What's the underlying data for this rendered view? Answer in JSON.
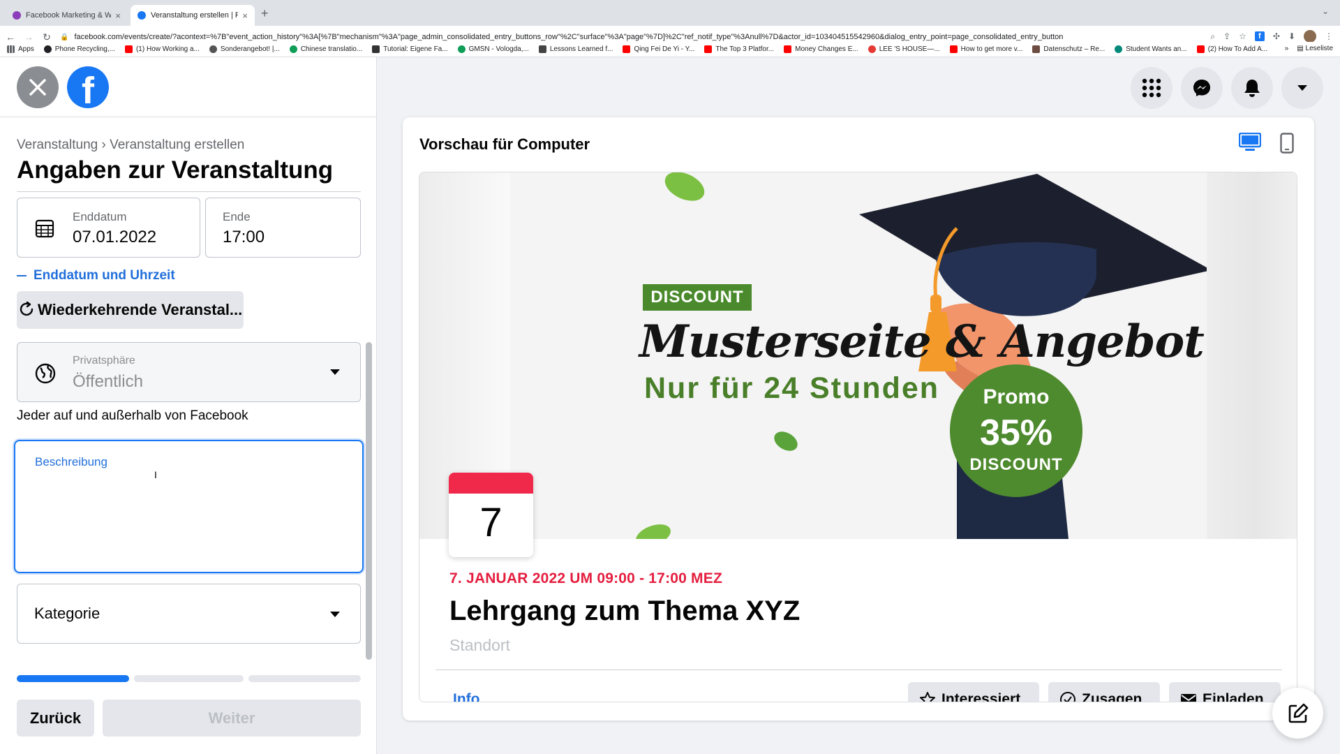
{
  "browser": {
    "tabs": [
      {
        "title": "Facebook Marketing & Werbea",
        "favicon_color": "#8b3dba"
      },
      {
        "title": "Veranstaltung erstellen | Faceb",
        "favicon_color": "#1877f2"
      }
    ],
    "new_tab": "+",
    "url": "facebook.com/events/create/?acontext=%7B\"event_action_history\"%3A[%7B\"mechanism\"%3A\"page_admin_consolidated_entry_buttons_row\"%2C\"surface\"%3A\"page\"%7D]%2C\"ref_notif_type\"%3Anull%7D&actor_id=103404515542960&dialog_entry_point=page_consolidated_entry_button",
    "bookmarks": [
      {
        "label": "Apps",
        "color": "#5f6368"
      },
      {
        "label": "Phone Recycling,...",
        "color": "#202124"
      },
      {
        "label": "(1) How Working a...",
        "color": "#ff0000"
      },
      {
        "label": "Sonderangebot! |...",
        "color": "#555555"
      },
      {
        "label": "Chinese translatio...",
        "color": "#0f9d58"
      },
      {
        "label": "Tutorial: Eigene Fa...",
        "color": "#333333"
      },
      {
        "label": "GMSN - Vologda,...",
        "color": "#0f9d58"
      },
      {
        "label": "Lessons Learned f...",
        "color": "#444444"
      },
      {
        "label": "Qing Fei De Yi - Y...",
        "color": "#ff0000"
      },
      {
        "label": "The Top 3 Platfor...",
        "color": "#ff0000"
      },
      {
        "label": "Money Changes E...",
        "color": "#ff0000"
      },
      {
        "label": "LEE 'S HOUSE—...",
        "color": "#e53935"
      },
      {
        "label": "How to get more v...",
        "color": "#ff0000"
      },
      {
        "label": "Datenschutz – Re...",
        "color": "#6d4c41"
      },
      {
        "label": "Student Wants an...",
        "color": "#00897b"
      },
      {
        "label": "(2) How To Add A...",
        "color": "#ff0000"
      }
    ],
    "bookmarks_more": "»",
    "reading_list": "Leseliste"
  },
  "left": {
    "breadcrumb": "Veranstaltung › Veranstaltung erstellen",
    "title": "Angaben zur Veranstaltung",
    "end_date_label": "Enddatum",
    "end_date_value": "07.01.2022",
    "end_time_label": "Ende",
    "end_time_value": "17:00",
    "end_link": "Enddatum und Uhrzeit",
    "recurring_label": "Wiederkehrende Veranstal...",
    "privacy_label": "Privatsphäre",
    "privacy_value": "Öffentlich",
    "privacy_desc": "Jeder auf und außerhalb von Facebook",
    "description_label": "Beschreibung",
    "category_label": "Kategorie",
    "back_label": "Zurück",
    "next_label": "Weiter",
    "progress_step": 1,
    "progress_steps": 3
  },
  "preview": {
    "title": "Vorschau für Computer",
    "cover": {
      "tag": "DISCOUNT",
      "headline": "Musterseite & Angebot",
      "subline": "Nur für 24 Stunden",
      "promo_line1": "Promo",
      "promo_line2": "35%",
      "promo_line3": "DISCOUNT"
    },
    "day": "7",
    "date_line": "7. JANUAR 2022 UM 09:00 - 17:00 MEZ",
    "event_title": "Lehrgang zum Thema XYZ",
    "location": "Standort",
    "info_tab": "Info",
    "btn_interested": "Interessiert",
    "btn_accept": "Zusagen",
    "btn_invite": "Einladen"
  },
  "colors": {
    "accent": "#1877f2",
    "date_red": "#e41e3f",
    "promo_green": "#4e8a2e"
  }
}
